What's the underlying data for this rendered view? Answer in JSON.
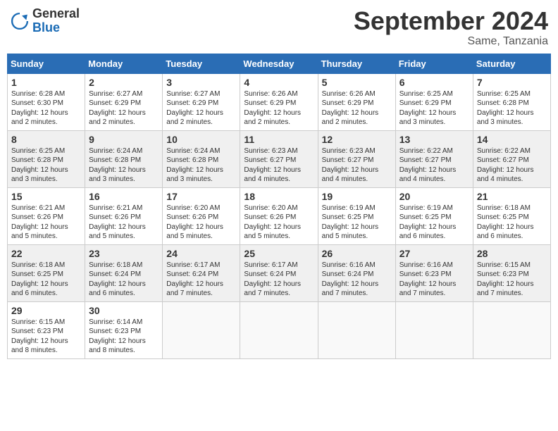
{
  "header": {
    "logo_general": "General",
    "logo_blue": "Blue",
    "month_year": "September 2024",
    "location": "Same, Tanzania"
  },
  "days_of_week": [
    "Sunday",
    "Monday",
    "Tuesday",
    "Wednesday",
    "Thursday",
    "Friday",
    "Saturday"
  ],
  "weeks": [
    [
      {
        "day": "1",
        "sunrise": "6:28 AM",
        "sunset": "6:30 PM",
        "daylight": "12 hours and 2 minutes."
      },
      {
        "day": "2",
        "sunrise": "6:27 AM",
        "sunset": "6:29 PM",
        "daylight": "12 hours and 2 minutes."
      },
      {
        "day": "3",
        "sunrise": "6:27 AM",
        "sunset": "6:29 PM",
        "daylight": "12 hours and 2 minutes."
      },
      {
        "day": "4",
        "sunrise": "6:26 AM",
        "sunset": "6:29 PM",
        "daylight": "12 hours and 2 minutes."
      },
      {
        "day": "5",
        "sunrise": "6:26 AM",
        "sunset": "6:29 PM",
        "daylight": "12 hours and 2 minutes."
      },
      {
        "day": "6",
        "sunrise": "6:25 AM",
        "sunset": "6:29 PM",
        "daylight": "12 hours and 3 minutes."
      },
      {
        "day": "7",
        "sunrise": "6:25 AM",
        "sunset": "6:28 PM",
        "daylight": "12 hours and 3 minutes."
      }
    ],
    [
      {
        "day": "8",
        "sunrise": "6:25 AM",
        "sunset": "6:28 PM",
        "daylight": "12 hours and 3 minutes."
      },
      {
        "day": "9",
        "sunrise": "6:24 AM",
        "sunset": "6:28 PM",
        "daylight": "12 hours and 3 minutes."
      },
      {
        "day": "10",
        "sunrise": "6:24 AM",
        "sunset": "6:28 PM",
        "daylight": "12 hours and 3 minutes."
      },
      {
        "day": "11",
        "sunrise": "6:23 AM",
        "sunset": "6:27 PM",
        "daylight": "12 hours and 4 minutes."
      },
      {
        "day": "12",
        "sunrise": "6:23 AM",
        "sunset": "6:27 PM",
        "daylight": "12 hours and 4 minutes."
      },
      {
        "day": "13",
        "sunrise": "6:22 AM",
        "sunset": "6:27 PM",
        "daylight": "12 hours and 4 minutes."
      },
      {
        "day": "14",
        "sunrise": "6:22 AM",
        "sunset": "6:27 PM",
        "daylight": "12 hours and 4 minutes."
      }
    ],
    [
      {
        "day": "15",
        "sunrise": "6:21 AM",
        "sunset": "6:26 PM",
        "daylight": "12 hours and 5 minutes."
      },
      {
        "day": "16",
        "sunrise": "6:21 AM",
        "sunset": "6:26 PM",
        "daylight": "12 hours and 5 minutes."
      },
      {
        "day": "17",
        "sunrise": "6:20 AM",
        "sunset": "6:26 PM",
        "daylight": "12 hours and 5 minutes."
      },
      {
        "day": "18",
        "sunrise": "6:20 AM",
        "sunset": "6:26 PM",
        "daylight": "12 hours and 5 minutes."
      },
      {
        "day": "19",
        "sunrise": "6:19 AM",
        "sunset": "6:25 PM",
        "daylight": "12 hours and 5 minutes."
      },
      {
        "day": "20",
        "sunrise": "6:19 AM",
        "sunset": "6:25 PM",
        "daylight": "12 hours and 6 minutes."
      },
      {
        "day": "21",
        "sunrise": "6:18 AM",
        "sunset": "6:25 PM",
        "daylight": "12 hours and 6 minutes."
      }
    ],
    [
      {
        "day": "22",
        "sunrise": "6:18 AM",
        "sunset": "6:25 PM",
        "daylight": "12 hours and 6 minutes."
      },
      {
        "day": "23",
        "sunrise": "6:18 AM",
        "sunset": "6:24 PM",
        "daylight": "12 hours and 6 minutes."
      },
      {
        "day": "24",
        "sunrise": "6:17 AM",
        "sunset": "6:24 PM",
        "daylight": "12 hours and 7 minutes."
      },
      {
        "day": "25",
        "sunrise": "6:17 AM",
        "sunset": "6:24 PM",
        "daylight": "12 hours and 7 minutes."
      },
      {
        "day": "26",
        "sunrise": "6:16 AM",
        "sunset": "6:24 PM",
        "daylight": "12 hours and 7 minutes."
      },
      {
        "day": "27",
        "sunrise": "6:16 AM",
        "sunset": "6:23 PM",
        "daylight": "12 hours and 7 minutes."
      },
      {
        "day": "28",
        "sunrise": "6:15 AM",
        "sunset": "6:23 PM",
        "daylight": "12 hours and 7 minutes."
      }
    ],
    [
      {
        "day": "29",
        "sunrise": "6:15 AM",
        "sunset": "6:23 PM",
        "daylight": "12 hours and 8 minutes."
      },
      {
        "day": "30",
        "sunrise": "6:14 AM",
        "sunset": "6:23 PM",
        "daylight": "12 hours and 8 minutes."
      },
      null,
      null,
      null,
      null,
      null
    ]
  ],
  "labels": {
    "sunrise": "Sunrise:",
    "sunset": "Sunset:",
    "daylight": "Daylight:"
  }
}
